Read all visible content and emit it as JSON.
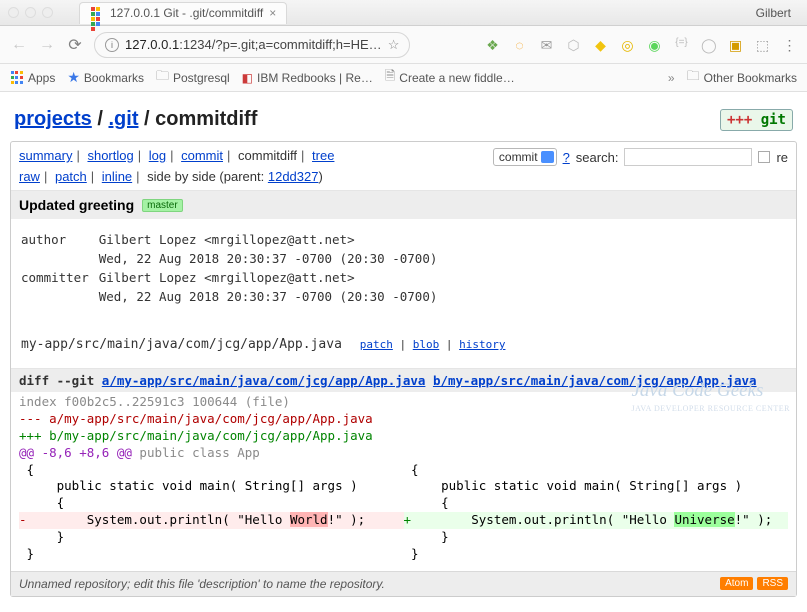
{
  "browser": {
    "user": "Gilbert",
    "tab_title": "127.0.0.1 Git - .git/commitdiff",
    "url_host": "127.0.0.1",
    "url_rest": ":1234/?p=.git;a=commitdiff;h=HE…",
    "bookmarks": {
      "apps": "Apps",
      "bookmarks": "Bookmarks",
      "postgresql": "Postgresql",
      "ibm": "IBM Redbooks | Re…",
      "fiddle": "Create a new fiddle…",
      "other": "Other Bookmarks"
    }
  },
  "crumb": {
    "projects": "projects",
    "git": ".git",
    "tail": "commitdiff",
    "gitlogo_plus": "+++",
    "gitlogo_text": "git"
  },
  "nav": {
    "summary": "summary",
    "shortlog": "shortlog",
    "log": "log",
    "commit": "commit",
    "commitdiff": "commitdiff",
    "tree": "tree",
    "raw": "raw",
    "patch": "patch",
    "inline": "inline",
    "sbs_prefix": "side by side (parent: ",
    "sbs_hash": "12dd327",
    "sbs_suffix": ")"
  },
  "search": {
    "select": "commit",
    "q": "?",
    "label": "search:",
    "re": "re"
  },
  "header": {
    "title": "Updated greeting",
    "branch": "master"
  },
  "meta": {
    "author_label": "author",
    "author_name": "Gilbert Lopez <mrgillopez@att.net>",
    "author_date": "Wed, 22 Aug 2018 20:30:37 -0700 (20:30 -0700)",
    "committer_label": "committer",
    "committer_name": "Gilbert Lopez <mrgillopez@att.net>",
    "committer_date": "Wed, 22 Aug 2018 20:30:37 -0700 (20:30 -0700)"
  },
  "file": {
    "path": "my-app/src/main/java/com/jcg/app/App.java",
    "patch": "patch",
    "blob": "blob",
    "history": "history"
  },
  "diff": {
    "cmd": "diff --git ",
    "a": "a/my-app/src/main/java/com/jcg/app/App.java",
    "b": "b/my-app/src/main/java/com/jcg/app/App.java",
    "index": "index f00b2c5..22591c3 100644 ",
    "file": "(file)",
    "minus": "--- a/",
    "plus": "+++ b/",
    "pathshort": "my-app/src/main/java/com/jcg/app/App.java",
    "hunk": "@@ -8,6 +8,6 @@",
    "hunkctx": " public class App",
    "brace_open": " {",
    "main_sig": "     public static void main( String[] args )",
    "brace_open2": "     {",
    "old_pre": "        System.out.println( \"Hello ",
    "old_word": "World",
    "old_post": "!\" );",
    "new_pre": "        System.out.println( \"Hello ",
    "new_word": "Universe",
    "new_post": "!\" );",
    "brace_close2": "     }",
    "brace_close": " }"
  },
  "footer": {
    "desc": "Unnamed repository; edit this file 'description' to name the repository.",
    "atom": "Atom",
    "rss": "RSS"
  },
  "watermark": {
    "t": "Java Code Geeks",
    "s": "JAVA DEVELOPER RESOURCE CENTER"
  }
}
